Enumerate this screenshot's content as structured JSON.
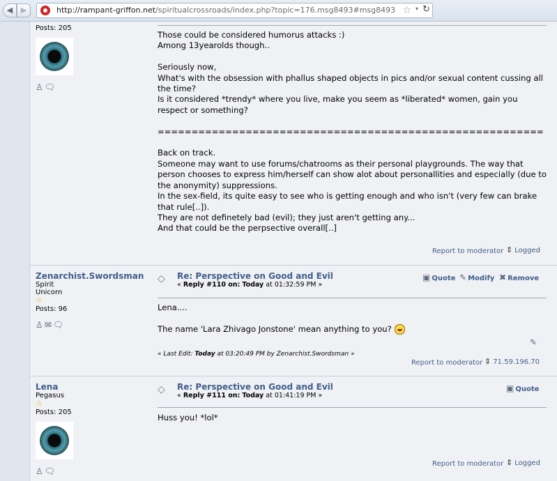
{
  "browser": {
    "url_host": "http://rampant-griffon.net",
    "url_path": "/spiritualcrossroads/index.php?topic=176.msg8493#msg8493",
    "back_icon": "back-arrow-icon",
    "forward_icon": "forward-arrow-icon"
  },
  "post1": {
    "posts": "Posts: 205",
    "body": [
      "Those could be considered humorus attacks :)",
      "Among 13yearolds though..",
      "",
      "Seriously now,",
      "What's with the obsession with phallus shaped objects in pics and/or sexual content cussing all the time?",
      "Is it considered *trendy* where you live, make you seem as *liberated* women, gain you respect or something?",
      "",
      "=========================================================",
      "",
      "Back on track.",
      "Someone may want to use forums/chatrooms as their personal playgrounds. The way that person chooses to express him/herself can show alot about personallities and especially (due to the anonymity) suppressions.",
      "In the sex-field, its quite easy to see who is getting enough and who isn't (very few can brake that rule[..]).",
      "They are not definetely bad (evil); they just aren't getting any...",
      "And that could be the perpsective overall[..]"
    ],
    "report": "Report to moderator",
    "logged": "Logged"
  },
  "post2": {
    "author": "Zenarchist.Swordsman",
    "rank1": "Spirit",
    "rank2": "Unicorn",
    "posts": "Posts: 96",
    "subject": "Re: Perspective on Good and Evil",
    "reply_prefix": "« ",
    "reply_label": "Reply #110 on:",
    "reply_day": "Today",
    "reply_time": " at 01:32:59 PM »",
    "quote": "Quote",
    "modify": "Modify",
    "remove": "Remove",
    "body_line1": "Lena....",
    "body_line2": "The name 'Lara Zhivago Jonstone' mean anything to you?",
    "lastedit_prefix": "« Last Edit: ",
    "lastedit_day": "Today",
    "lastedit_rest": " at 03:20:49 PM by Zenarchist.Swordsman »",
    "report": "Report to moderator",
    "ip": "71.59.196.70"
  },
  "post3": {
    "author": "Lena",
    "rank1": "Pegasus",
    "posts": "Posts: 205",
    "subject": "Re: Perspective on Good and Evil",
    "reply_prefix": "« ",
    "reply_label": "Reply #111 on:",
    "reply_day": "Today",
    "reply_time": " at 01:41:19 PM »",
    "quote": "Quote",
    "body": "Huss you! *lol*",
    "report": "Report to moderator",
    "logged": "Logged"
  },
  "colors": {
    "link": "#3f5e8c",
    "post_bg": "#f0f1f4",
    "page_bg": "#dfe6ef"
  }
}
